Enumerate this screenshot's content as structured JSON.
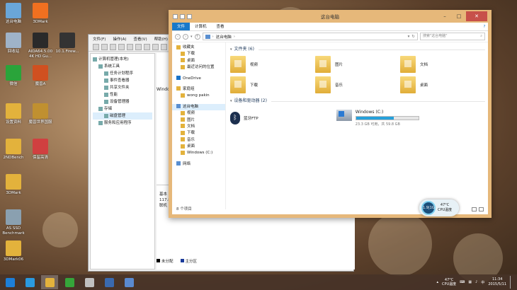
{
  "desktop": {
    "icons": [
      {
        "label": "这台电脑",
        "color": "#6aa6d8"
      },
      {
        "label": "3DMark",
        "color": "#f07020"
      },
      {
        "label": "回收站",
        "color": "#9fb3c8"
      },
      {
        "label": "AIDA64.5.00 4K HD Gu...",
        "color": "#2a2a2a"
      },
      {
        "label": "10.1.Firew...",
        "color": "#333333"
      },
      {
        "label": "微信",
        "color": "#2aa43a"
      },
      {
        "label": "魔兽A",
        "color": "#d05020"
      },
      {
        "label": "设置资料",
        "color": "#e3b23c"
      },
      {
        "label": "魔兽世界国服",
        "color": "#c09030"
      },
      {
        "label": "2NDBench",
        "color": "#e3b23c"
      },
      {
        "label": "保留高清",
        "color": "#d04040"
      },
      {
        "label": "3DMark",
        "color": "#e3b23c"
      },
      {
        "label": "AS SSD Benchmark",
        "color": "#8aa0b0"
      },
      {
        "label": "3DMark06",
        "color": "#e3b23c"
      }
    ]
  },
  "computer_management": {
    "menu": [
      "文件(F)",
      "操作(A)",
      "查看(V)",
      "帮助(H)"
    ],
    "tree": [
      {
        "label": "计算机管理(本地)",
        "indent": 0
      },
      {
        "label": "系统工具",
        "indent": 1
      },
      {
        "label": "任务计划程序",
        "indent": 2
      },
      {
        "label": "事件查看器",
        "indent": 2
      },
      {
        "label": "共享文件夹",
        "indent": 2
      },
      {
        "label": "性能",
        "indent": 2
      },
      {
        "label": "设备管理器",
        "indent": 2
      },
      {
        "label": "存储",
        "indent": 1
      },
      {
        "label": "磁盘管理",
        "indent": 2
      },
      {
        "label": "服务和应用程序",
        "indent": 1
      }
    ],
    "mid_text": "Windo",
    "disk_info": [
      "基本",
      "117.8",
      "联机"
    ],
    "legend": [
      "未分配",
      "主分区"
    ]
  },
  "explorer": {
    "title": "这台电脑",
    "ribbon_tabs": [
      "文件",
      "计算机",
      "查看"
    ],
    "address": "这台电脑",
    "search_placeholder": "搜索\"这台电脑\"",
    "nav": [
      {
        "label": "收藏夹",
        "type": "header"
      },
      {
        "label": "下载",
        "type": "sub"
      },
      {
        "label": "桌面",
        "type": "sub"
      },
      {
        "label": "最近访问的位置",
        "type": "sub"
      },
      {
        "label": "OneDrive",
        "type": "header"
      },
      {
        "label": "家庭组",
        "type": "header"
      },
      {
        "label": "wong pakin",
        "type": "sub"
      },
      {
        "label": "这台电脑",
        "type": "header-sel"
      },
      {
        "label": "视频",
        "type": "sub"
      },
      {
        "label": "图片",
        "type": "sub"
      },
      {
        "label": "文档",
        "type": "sub"
      },
      {
        "label": "下载",
        "type": "sub"
      },
      {
        "label": "音乐",
        "type": "sub"
      },
      {
        "label": "桌面",
        "type": "sub"
      },
      {
        "label": "Windows (C:)",
        "type": "sub"
      },
      {
        "label": "网络",
        "type": "header"
      }
    ],
    "folders_header": "文件夹 (6)",
    "folders": [
      "视频",
      "图片",
      "文档",
      "下载",
      "音乐",
      "桌面"
    ],
    "devices_header": "设备和驱动器 (2)",
    "bt_label": "蓝牙FTP",
    "drive_label": "Windows (C:)",
    "drive_free": "23.3 GB 可用，共 59.8 GB",
    "drive_used_fraction": 0.61,
    "status": "8 个项目"
  },
  "gadget": {
    "percent": "1.9|1G",
    "temp": "47°C",
    "label": "CPU温度"
  },
  "taskbar": {
    "apps": [
      {
        "name": "start",
        "color": "#1d7fd8"
      },
      {
        "name": "ie",
        "color": "#2a9ae0"
      },
      {
        "name": "explorer",
        "color": "#e3b23c"
      },
      {
        "name": "store",
        "color": "#35a53a"
      },
      {
        "name": "app4",
        "color": "#c0c0c0"
      },
      {
        "name": "app5",
        "color": "#3a6ab0"
      },
      {
        "name": "app6",
        "color": "#5a8ad0"
      }
    ],
    "temp": "47°C",
    "temp_label": "CPU温度",
    "time": "11:34",
    "date": "2015/5/11"
  }
}
